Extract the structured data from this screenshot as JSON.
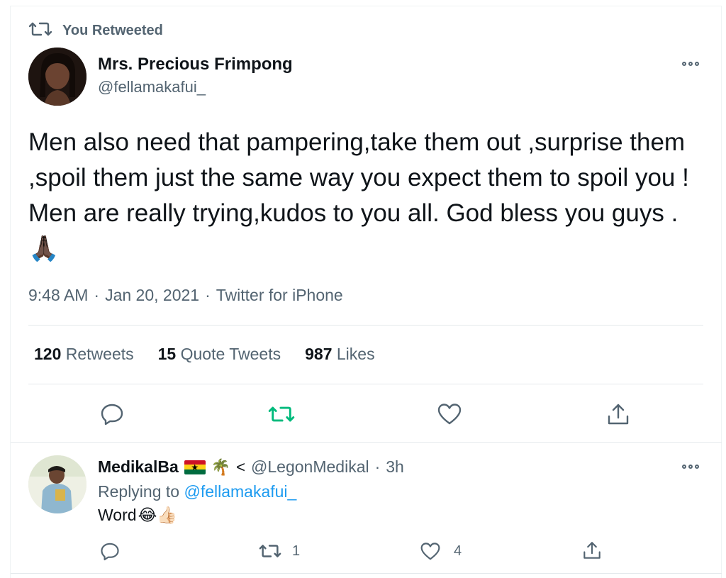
{
  "retweet_banner": {
    "label": "You Retweeted"
  },
  "tweet": {
    "author_name": "Mrs. Precious Frimpong",
    "author_handle": "@fellamakafui_",
    "text": "Men also need that pampering,take them out ,surprise them ,spoil them just the same way you expect them to spoil you ! Men are really trying,kudos to you all. God bless you guys . 🙏🏿",
    "time": "9:48 AM",
    "date": "Jan 20, 2021",
    "source": "Twitter for iPhone",
    "separator": "·",
    "stats": {
      "retweets_count": "120",
      "retweets_label": "Retweets",
      "quotes_count": "15",
      "quotes_label": "Quote Tweets",
      "likes_count": "987",
      "likes_label": "Likes"
    }
  },
  "reply": {
    "author_name": "MedikalBa",
    "author_emojis": "🌴",
    "author_extra": "<",
    "author_handle": "@LegonMedikal",
    "separator": "·",
    "time": "3h",
    "replying_prefix": "Replying to",
    "replying_handle": "@fellamakafui_",
    "text": "Word",
    "text_emojis": "😂👍🏻",
    "retweet_count": "1",
    "like_count": "4"
  },
  "colors": {
    "retweet_active": "#00ba7c",
    "link": "#1d9bf0",
    "muted": "#536471"
  },
  "icons": {
    "retweet_banner": "retweet-icon",
    "reply": "reply-icon",
    "retweet": "retweet-icon",
    "like": "heart-icon",
    "share": "share-icon",
    "more": "more-icon"
  }
}
